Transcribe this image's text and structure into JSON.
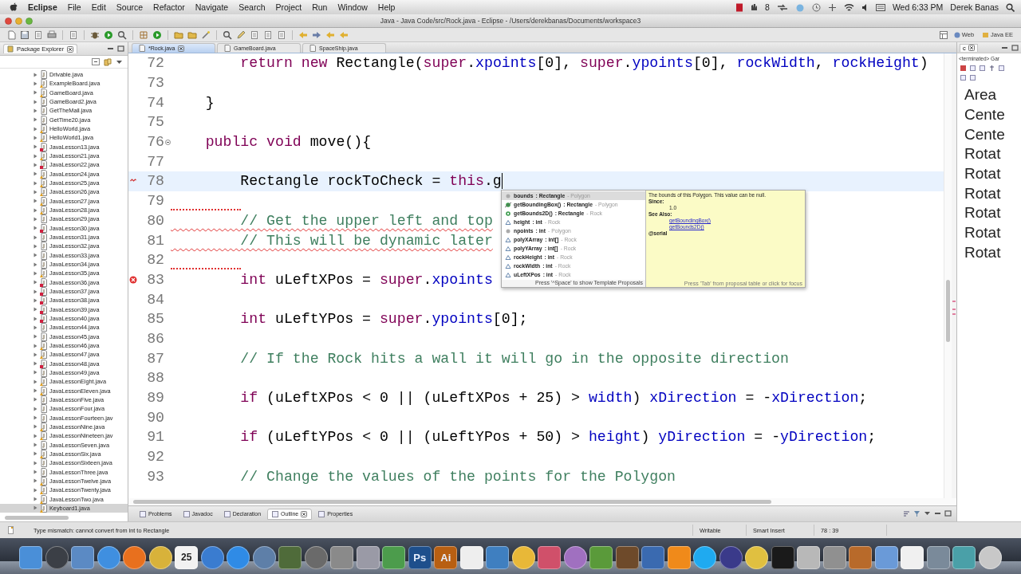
{
  "menu_bar": {
    "app": "Eclipse",
    "items": [
      "File",
      "Edit",
      "Source",
      "Refactor",
      "Navigate",
      "Search",
      "Project",
      "Run",
      "Window",
      "Help"
    ],
    "badge": "8",
    "clock": "Wed 6:33 PM",
    "user": "Derek Banas"
  },
  "window": {
    "title": "Java - Java Code/src/Rock.java - Eclipse - /Users/derekbanas/Documents/workspace3"
  },
  "perspectives": [
    "Web",
    "Java EE"
  ],
  "package_explorer": {
    "title": "Package Explorer",
    "items": [
      {
        "name": "Drivable.java",
        "error": false,
        "warning": false,
        "selected": false
      },
      {
        "name": "ExampleBoard.java",
        "error": false,
        "warning": true,
        "selected": false
      },
      {
        "name": "GameBoard.java",
        "error": false,
        "warning": true,
        "selected": false
      },
      {
        "name": "GameBoard2.java",
        "error": false,
        "warning": false,
        "selected": false
      },
      {
        "name": "GetTheMail.java",
        "error": false,
        "warning": false,
        "selected": false
      },
      {
        "name": "GetTime20.java",
        "error": false,
        "warning": false,
        "selected": false
      },
      {
        "name": "HelloWorld.java",
        "error": false,
        "warning": true,
        "selected": false
      },
      {
        "name": "HelloWorld1.java",
        "error": false,
        "warning": true,
        "selected": false
      },
      {
        "name": "JavaLesson13.java",
        "error": true,
        "warning": false,
        "selected": false
      },
      {
        "name": "JavaLesson21.java",
        "error": false,
        "warning": true,
        "selected": false
      },
      {
        "name": "JavaLesson22.java",
        "error": true,
        "warning": false,
        "selected": false
      },
      {
        "name": "JavaLesson24.java",
        "error": false,
        "warning": true,
        "selected": false
      },
      {
        "name": "JavaLesson25.java",
        "error": false,
        "warning": true,
        "selected": false
      },
      {
        "name": "JavaLesson26.java",
        "error": false,
        "warning": true,
        "selected": false
      },
      {
        "name": "JavaLesson27.java",
        "error": false,
        "warning": true,
        "selected": false
      },
      {
        "name": "JavaLesson28.java",
        "error": false,
        "warning": true,
        "selected": false
      },
      {
        "name": "JavaLesson29.java",
        "error": false,
        "warning": false,
        "selected": false
      },
      {
        "name": "JavaLesson30.java",
        "error": true,
        "warning": false,
        "selected": false
      },
      {
        "name": "JavaLesson31.java",
        "error": false,
        "warning": false,
        "selected": false
      },
      {
        "name": "JavaLesson32.java",
        "error": false,
        "warning": false,
        "selected": false
      },
      {
        "name": "JavaLesson33.java",
        "error": false,
        "warning": false,
        "selected": false
      },
      {
        "name": "JavaLesson34.java",
        "error": false,
        "warning": false,
        "selected": false
      },
      {
        "name": "JavaLesson35.java",
        "error": false,
        "warning": true,
        "selected": false
      },
      {
        "name": "JavaLesson36.java",
        "error": true,
        "warning": false,
        "selected": false
      },
      {
        "name": "JavaLesson37.java",
        "error": true,
        "warning": false,
        "selected": false
      },
      {
        "name": "JavaLesson38.java",
        "error": true,
        "warning": false,
        "selected": false
      },
      {
        "name": "JavaLesson39.java",
        "error": true,
        "warning": false,
        "selected": false
      },
      {
        "name": "JavaLesson40.java",
        "error": true,
        "warning": false,
        "selected": false
      },
      {
        "name": "JavaLesson44.java",
        "error": false,
        "warning": false,
        "selected": false
      },
      {
        "name": "JavaLesson45.java",
        "error": false,
        "warning": false,
        "selected": false
      },
      {
        "name": "JavaLesson46.java",
        "error": false,
        "warning": true,
        "selected": false
      },
      {
        "name": "JavaLesson47.java",
        "error": false,
        "warning": true,
        "selected": false
      },
      {
        "name": "JavaLesson48.java",
        "error": true,
        "warning": false,
        "selected": false
      },
      {
        "name": "JavaLesson49.java",
        "error": false,
        "warning": false,
        "selected": false
      },
      {
        "name": "JavaLessonEight.java",
        "error": false,
        "warning": true,
        "selected": false
      },
      {
        "name": "JavaLessonEleven.java",
        "error": false,
        "warning": true,
        "selected": false
      },
      {
        "name": "JavaLessonFive.java",
        "error": false,
        "warning": false,
        "selected": false
      },
      {
        "name": "JavaLessonFour.java",
        "error": false,
        "warning": false,
        "selected": false
      },
      {
        "name": "JavaLessonFourteen.jav",
        "error": false,
        "warning": false,
        "selected": false
      },
      {
        "name": "JavaLessonNine.java",
        "error": false,
        "warning": true,
        "selected": false
      },
      {
        "name": "JavaLessonNineteen.jav",
        "error": false,
        "warning": true,
        "selected": false
      },
      {
        "name": "JavaLessonSeven.java",
        "error": false,
        "warning": false,
        "selected": false
      },
      {
        "name": "JavaLessonSix.java",
        "error": false,
        "warning": true,
        "selected": false
      },
      {
        "name": "JavaLessonSixteen.java",
        "error": false,
        "warning": false,
        "selected": false
      },
      {
        "name": "JavaLessonThree.java",
        "error": false,
        "warning": false,
        "selected": false
      },
      {
        "name": "JavaLessonTwelve.java",
        "error": false,
        "warning": true,
        "selected": false
      },
      {
        "name": "JavaLessonTwenty.java",
        "error": false,
        "warning": true,
        "selected": false
      },
      {
        "name": "JavaLessonTwo.java",
        "error": false,
        "warning": true,
        "selected": false
      },
      {
        "name": "Keyboard1.java",
        "error": false,
        "warning": true,
        "selected": true
      }
    ]
  },
  "editor_tabs": [
    {
      "label": "*Rock.java",
      "selected": true
    },
    {
      "label": "GameBoard.java",
      "selected": false
    },
    {
      "label": "SpaceShip.java",
      "selected": false
    }
  ],
  "editor": {
    "lines": [
      {
        "number": "72",
        "current": false,
        "error": false,
        "code": [
          {
            "text": "        return",
            "kind": "keyword"
          },
          {
            "text": " new",
            "kind": "keyword"
          },
          {
            "text": " Rectangle(",
            "kind": "plain"
          },
          {
            "text": "super",
            "kind": "keyword"
          },
          {
            "text": ".",
            "kind": "plain"
          },
          {
            "text": "xpoints",
            "kind": "field"
          },
          {
            "text": "[0], ",
            "kind": "plain"
          },
          {
            "text": "super",
            "kind": "keyword"
          },
          {
            "text": ".",
            "kind": "plain"
          },
          {
            "text": "ypoints",
            "kind": "field"
          },
          {
            "text": "[0], ",
            "kind": "plain"
          },
          {
            "text": "rockWidth",
            "kind": "field"
          },
          {
            "text": ", ",
            "kind": "plain"
          },
          {
            "text": "rockHeight",
            "kind": "field"
          },
          {
            "text": ")",
            "kind": "plain"
          }
        ]
      },
      {
        "number": "73",
        "current": false,
        "error": false
      },
      {
        "number": "74",
        "current": false,
        "error": false,
        "code": [
          {
            "text": "    }",
            "kind": "plain"
          }
        ]
      },
      {
        "number": "75",
        "current": false,
        "error": false
      },
      {
        "number": "76",
        "current": false,
        "error": false,
        "fold": true,
        "code": [
          {
            "text": "    public",
            "kind": "keyword"
          },
          {
            "text": " void",
            "kind": "keyword"
          },
          {
            "text": " move(){",
            "kind": "plain"
          }
        ]
      },
      {
        "number": "77",
        "current": false,
        "error": false
      },
      {
        "number": "78",
        "current": true,
        "error": false,
        "problem_marker": true,
        "code": [
          {
            "text": "        Rectangle rockToCheck = ",
            "kind": "plain"
          },
          {
            "text": "this",
            "kind": "keyword"
          },
          {
            "text": ".g",
            "kind": "plain"
          }
        ]
      },
      {
        "number": "79",
        "current": false,
        "error": true
      },
      {
        "number": "80",
        "current": false,
        "error": true,
        "code": [
          {
            "text": "        // Get the upper left and top",
            "kind": "comment"
          }
        ]
      },
      {
        "number": "81",
        "current": false,
        "error": true,
        "code": [
          {
            "text": "        // This will be dynamic later",
            "kind": "comment"
          }
        ]
      },
      {
        "number": "82",
        "current": false,
        "error": true
      },
      {
        "number": "83",
        "current": false,
        "error": false,
        "error_marker": true,
        "code": [
          {
            "text": "        int",
            "kind": "keyword"
          },
          {
            "text": " uLeftXPos = ",
            "kind": "plain"
          },
          {
            "text": "super",
            "kind": "keyword"
          },
          {
            "text": ".",
            "kind": "plain"
          },
          {
            "text": "xpoints",
            "kind": "field"
          }
        ]
      },
      {
        "number": "84",
        "current": false,
        "error": false
      },
      {
        "number": "85",
        "current": false,
        "error": false,
        "code": [
          {
            "text": "        int",
            "kind": "keyword"
          },
          {
            "text": " uLeftYPos = ",
            "kind": "plain"
          },
          {
            "text": "super",
            "kind": "keyword"
          },
          {
            "text": ".",
            "kind": "plain"
          },
          {
            "text": "ypoints",
            "kind": "field"
          },
          {
            "text": "[0];",
            "kind": "plain"
          }
        ]
      },
      {
        "number": "86",
        "current": false,
        "error": false
      },
      {
        "number": "87",
        "current": false,
        "error": false,
        "code": [
          {
            "text": "        // If the Rock hits a wall it will go in the opposite direction",
            "kind": "comment"
          }
        ]
      },
      {
        "number": "88",
        "current": false,
        "error": false
      },
      {
        "number": "89",
        "current": false,
        "error": false,
        "code": [
          {
            "text": "        if",
            "kind": "keyword"
          },
          {
            "text": " (uLeftXPos < 0 || (uLeftXPos + 25) > ",
            "kind": "plain"
          },
          {
            "text": "width",
            "kind": "field"
          },
          {
            "text": ") ",
            "kind": "plain"
          },
          {
            "text": "xDirection",
            "kind": "field"
          },
          {
            "text": " = -",
            "kind": "plain"
          },
          {
            "text": "xDirection",
            "kind": "field"
          },
          {
            "text": ";",
            "kind": "plain"
          }
        ]
      },
      {
        "number": "90",
        "current": false,
        "error": false
      },
      {
        "number": "91",
        "current": false,
        "error": false,
        "code": [
          {
            "text": "        if",
            "kind": "keyword"
          },
          {
            "text": " (uLeftYPos < 0 || (uLeftYPos + 50) > ",
            "kind": "plain"
          },
          {
            "text": "height",
            "kind": "field"
          },
          {
            "text": ") ",
            "kind": "plain"
          },
          {
            "text": "yDirection",
            "kind": "field"
          },
          {
            "text": " = -",
            "kind": "plain"
          },
          {
            "text": "yDirection",
            "kind": "field"
          },
          {
            "text": ";",
            "kind": "plain"
          }
        ]
      },
      {
        "number": "92",
        "current": false,
        "error": false
      },
      {
        "number": "93",
        "current": false,
        "error": false,
        "code": [
          {
            "text": "        // Change the values of the points for the Polygon",
            "kind": "comment"
          }
        ]
      }
    ],
    "completion": {
      "items": [
        {
          "kind": "public-field",
          "name": "bounds",
          "type": " : Rectangle",
          "owner": " - Polygon",
          "selected": true
        },
        {
          "kind": "deprecated-method",
          "name": "getBoundingBox()",
          "type": " : Rectangle",
          "owner": " - Polygon",
          "selected": false
        },
        {
          "kind": "method",
          "name": "getBounds2D()",
          "type": " : Rectangle",
          "owner": " - Rock",
          "selected": false
        },
        {
          "kind": "field",
          "name": "height",
          "type": " : int",
          "owner": " - Rock",
          "selected": false
        },
        {
          "kind": "public-field",
          "name": "npoints",
          "type": " : int",
          "owner": " - Polygon",
          "selected": false
        },
        {
          "kind": "field",
          "name": "polyXArray",
          "type": " : int[]",
          "owner": " - Rock",
          "selected": false
        },
        {
          "kind": "field",
          "name": "polyYArray",
          "type": " : int[]",
          "owner": " - Rock",
          "selected": false
        },
        {
          "kind": "field",
          "name": "rockHeight",
          "type": " : int",
          "owner": " - Rock",
          "selected": false
        },
        {
          "kind": "field",
          "name": "rockWidth",
          "type": " : int",
          "owner": " - Rock",
          "selected": false
        },
        {
          "kind": "field",
          "name": "uLeftXPos",
          "type": " : int",
          "owner": " - Rock",
          "selected": false
        }
      ],
      "hint": "Press '^Space' to show Template Proposals",
      "doc": {
        "summary": "The bounds of this Polygon. This value can be null.",
        "since_label": "Since:",
        "since": "1.0",
        "see_also_label": "See Also:",
        "links": [
          "getBoundingBox()",
          "getBounds2D()"
        ],
        "tag": "@serial",
        "hint": "Press 'Tab' from proposal table or click for focus"
      }
    }
  },
  "outline": {
    "tab": "c",
    "status": "<terminated> Gar",
    "items": [
      "Area",
      "Cente",
      "Cente",
      "Rotat",
      "Rotat",
      "Rotat",
      "Rotat",
      "Rotat",
      "Rotat"
    ]
  },
  "bottom_tabs": [
    {
      "label": "Problems",
      "selected": false
    },
    {
      "label": "Javadoc",
      "selected": false
    },
    {
      "label": "Declaration",
      "selected": false
    },
    {
      "label": "Outline",
      "selected": true
    },
    {
      "label": "Properties",
      "selected": false
    }
  ],
  "status_bar": {
    "message": "Type mismatch: cannot convert from int to Rectangle",
    "mode": "Writable",
    "insert": "Smart Insert",
    "position": "78 : 39"
  },
  "dock": [
    {
      "kind": "square",
      "color": "#4a8fd8"
    },
    {
      "kind": "round",
      "color": "#3b3f46"
    },
    {
      "kind": "square",
      "color": "#5b8ac4"
    },
    {
      "kind": "round",
      "color": "#3f8fe0"
    },
    {
      "kind": "round",
      "color": "#e8701e"
    },
    {
      "kind": "round",
      "color": "#d8b23a"
    },
    {
      "kind": "labeled",
      "color": "#f2f2f2",
      "label": "25"
    },
    {
      "kind": "round",
      "color": "#3a7cd0"
    },
    {
      "kind": "round",
      "color": "#2f8be6"
    },
    {
      "kind": "round",
      "color": "#5e7fa8"
    },
    {
      "kind": "square",
      "color": "#4f6b3a"
    },
    {
      "kind": "round",
      "color": "#6a6a6a"
    },
    {
      "kind": "square",
      "color": "#8a8a8a"
    },
    {
      "kind": "square",
      "color": "#9a9aa6"
    },
    {
      "kind": "square",
      "color": "#4c9c4c"
    },
    {
      "kind": "labeled",
      "color": "#1e4f8c",
      "label": "Ps"
    },
    {
      "kind": "labeled",
      "color": "#b85f12",
      "label": "Ai"
    },
    {
      "kind": "square",
      "color": "#eeeeee"
    },
    {
      "kind": "square",
      "color": "#3f7fc0"
    },
    {
      "kind": "round",
      "color": "#e8b838"
    },
    {
      "kind": "square",
      "color": "#d0506a"
    },
    {
      "kind": "round",
      "color": "#a070c0"
    },
    {
      "kind": "square",
      "color": "#5a9a3a"
    },
    {
      "kind": "square",
      "color": "#6e4a2a"
    },
    {
      "kind": "square",
      "color": "#3a6ab0"
    },
    {
      "kind": "square",
      "color": "#f08a1a"
    },
    {
      "kind": "round",
      "color": "#1faaf0"
    },
    {
      "kind": "round",
      "color": "#3a3a8a"
    },
    {
      "kind": "round",
      "color": "#e0c040"
    },
    {
      "kind": "square",
      "color": "#1a1a1a"
    },
    {
      "kind": "square",
      "color": "#b8b8b8"
    },
    {
      "kind": "square",
      "color": "#909090"
    },
    {
      "kind": "square",
      "color": "#b86a2a"
    },
    {
      "kind": "square",
      "color": "#6a9ad8"
    },
    {
      "kind": "square",
      "color": "#f0f0f0"
    },
    {
      "kind": "square",
      "color": "#7a8a9a"
    },
    {
      "kind": "square",
      "color": "#4aa0a8"
    },
    {
      "kind": "round",
      "color": "#c8c8c8"
    }
  ]
}
